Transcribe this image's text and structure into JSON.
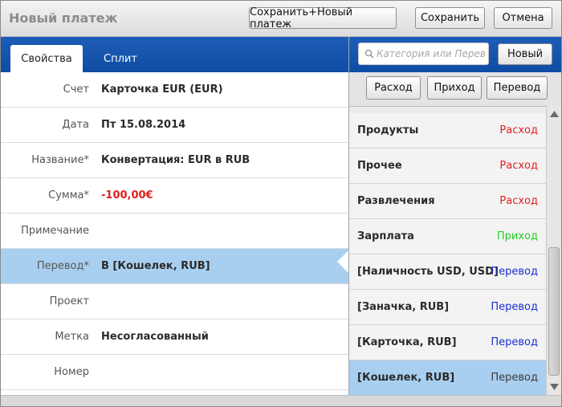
{
  "window": {
    "title": "Новый платеж",
    "buttons": {
      "save_new": "Сохранить+Новый платеж",
      "save": "Сохранить",
      "cancel": "Отмена"
    }
  },
  "tabs": [
    {
      "label": "Свойства",
      "active": true
    },
    {
      "label": "Сплит",
      "active": false
    }
  ],
  "form": {
    "rows": [
      {
        "label": "Счет",
        "value": "Карточка EUR (EUR)"
      },
      {
        "label": "Дата",
        "value": "Пт 15.08.2014"
      },
      {
        "label": "Название*",
        "value": "Конвертация: EUR в RUB"
      },
      {
        "label": "Сумма*",
        "value": "-100,00€"
      },
      {
        "label": "Примечание",
        "value": ""
      },
      {
        "label": "Перевод*",
        "value": "В [Кошелек, RUB]"
      },
      {
        "label": "Проект",
        "value": ""
      },
      {
        "label": "Метка",
        "value": "Несогласованный"
      },
      {
        "label": "Номер",
        "value": ""
      }
    ]
  },
  "panel": {
    "search_placeholder": "Категория или Перевод",
    "new_button": "Новый",
    "filters": {
      "expense": "Расход",
      "income": "Приход",
      "transfer": "Перевод"
    },
    "items": [
      {
        "name": "Продукты",
        "type": "Расход"
      },
      {
        "name": "Прочее",
        "type": "Расход"
      },
      {
        "name": "Развлечения",
        "type": "Расход"
      },
      {
        "name": "Зарплата",
        "type": "Приход"
      },
      {
        "name": "[Наличность USD, USD]",
        "type": "Перевод"
      },
      {
        "name": "[Заначка, RUB]",
        "type": "Перевод"
      },
      {
        "name": "[Карточка, RUB]",
        "type": "Перевод"
      },
      {
        "name": "[Кошелек, RUB]",
        "type": "Перевод",
        "selected": true
      }
    ]
  },
  "colors": {
    "expense": "#e02020",
    "income": "#22cc22",
    "transfer": "#1a2fd6",
    "selected_transfer": "#3a3a3a",
    "tab_bar": "#1554ad",
    "selection": "#a9cff0"
  }
}
